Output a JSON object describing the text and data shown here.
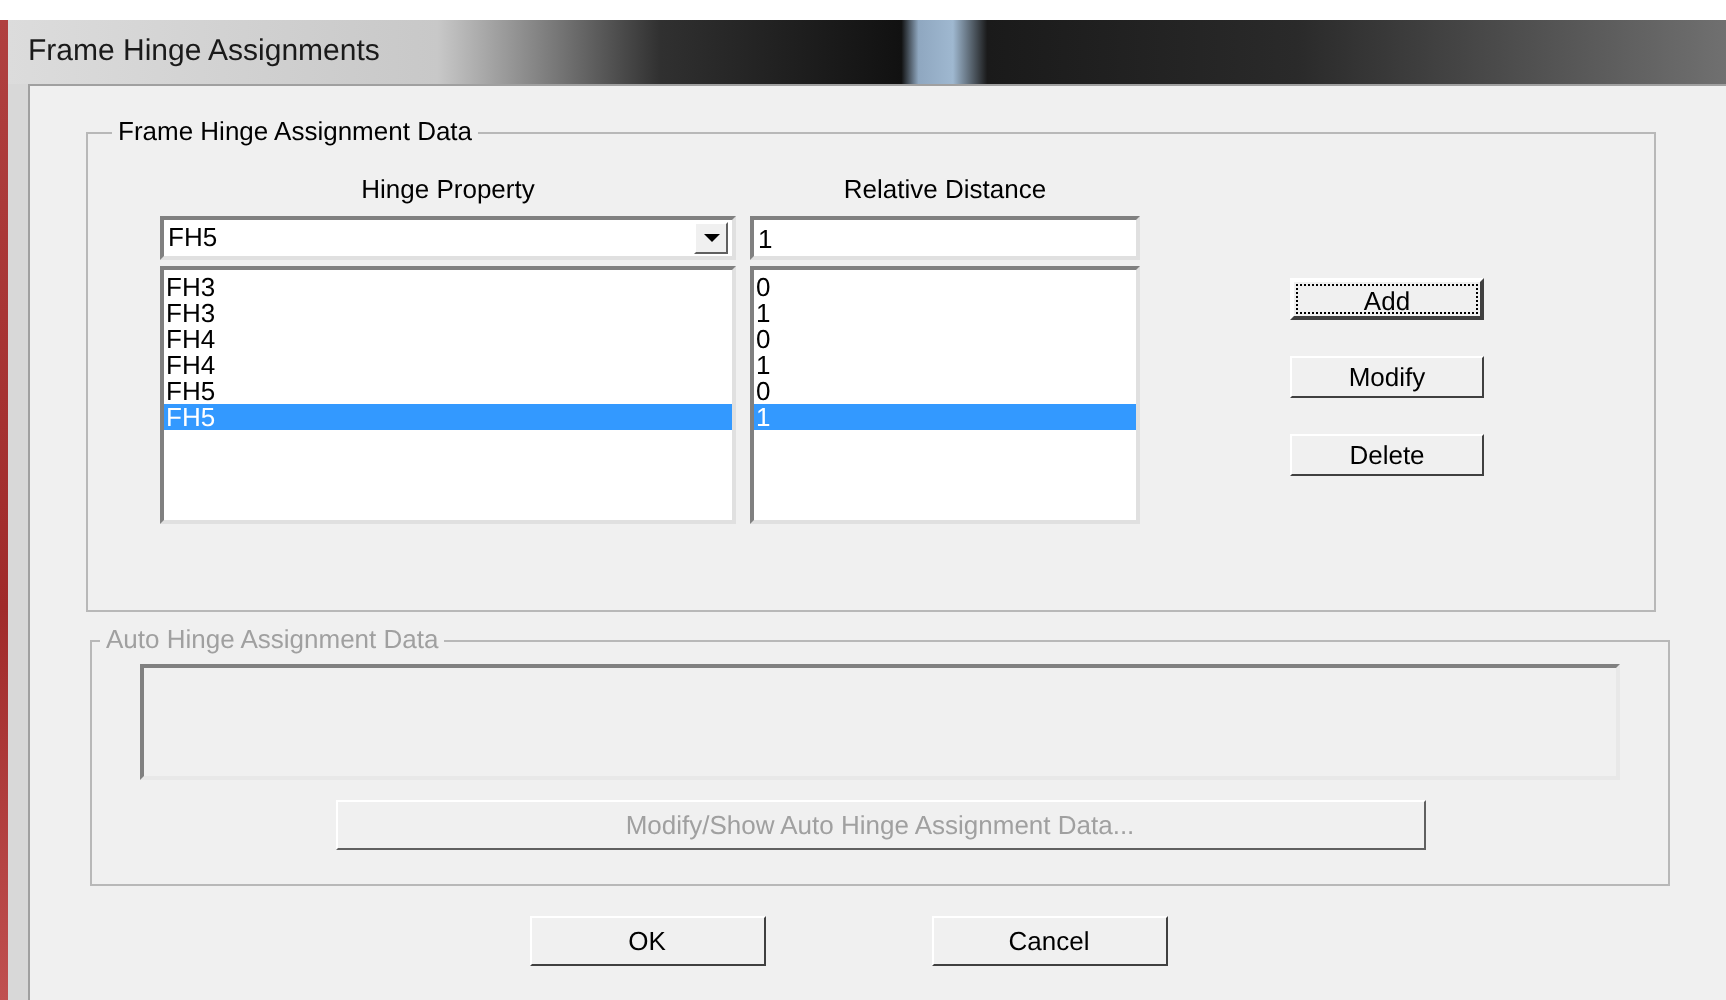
{
  "window": {
    "title": "Frame Hinge Assignments"
  },
  "hinge_group": {
    "title": "Frame Hinge Assignment Data",
    "columns": [
      "Hinge Property",
      "Relative Distance"
    ],
    "hinge_property": {
      "value": "FH5"
    },
    "relative_distance": {
      "value": "1"
    },
    "rows": [
      {
        "hinge_property": "FH3",
        "relative_distance": "0",
        "selected": false
      },
      {
        "hinge_property": "FH3",
        "relative_distance": "1",
        "selected": false
      },
      {
        "hinge_property": "FH4",
        "relative_distance": "0",
        "selected": false
      },
      {
        "hinge_property": "FH4",
        "relative_distance": "1",
        "selected": false
      },
      {
        "hinge_property": "FH5",
        "relative_distance": "0",
        "selected": false
      },
      {
        "hinge_property": "FH5",
        "relative_distance": "1",
        "selected": true
      }
    ],
    "buttons": [
      {
        "label": "Add",
        "focused": true
      },
      {
        "label": "Modify",
        "focused": false
      },
      {
        "label": "Delete",
        "focused": false
      }
    ]
  },
  "auto_group": {
    "title": "Auto Hinge Assignment Data",
    "disabled": true,
    "button": {
      "label": "Modify/Show Auto Hinge Assignment Data...",
      "disabled": true
    }
  },
  "buttons": [
    {
      "label": "OK"
    },
    {
      "label": "Cancel"
    }
  ]
}
